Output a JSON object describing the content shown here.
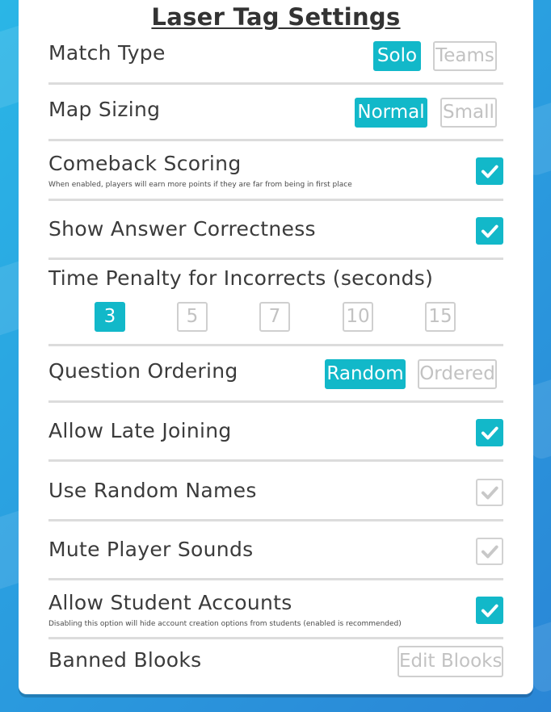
{
  "title": "Laser Tag Settings",
  "colors": {
    "accent": "#12b8c9",
    "inactive_border": "#cfcfcf",
    "text": "#3b3b3b"
  },
  "settings": {
    "match_type": {
      "label": "Match Type",
      "options": [
        "Solo",
        "Teams"
      ],
      "selected": "Solo"
    },
    "map_sizing": {
      "label": "Map Sizing",
      "options": [
        "Normal",
        "Small"
      ],
      "selected": "Normal"
    },
    "comeback_scoring": {
      "label": "Comeback Scoring",
      "description": "When enabled, players will earn more points if they are far from being in first place",
      "checked": true
    },
    "show_answer_correctness": {
      "label": "Show Answer Correctness",
      "checked": true
    },
    "time_penalty": {
      "label": "Time Penalty for Incorrects (seconds)",
      "options": [
        "3",
        "5",
        "7",
        "10",
        "15"
      ],
      "selected": "3"
    },
    "question_ordering": {
      "label": "Question Ordering",
      "options": [
        "Random",
        "Ordered"
      ],
      "selected": "Random"
    },
    "allow_late_joining": {
      "label": "Allow Late Joining",
      "checked": true
    },
    "use_random_names": {
      "label": "Use Random Names",
      "checked": false
    },
    "mute_player_sounds": {
      "label": "Mute Player Sounds",
      "checked": false
    },
    "allow_student_accounts": {
      "label": "Allow Student Accounts",
      "description": "Disabling this option will hide account creation options from students (enabled is recommended)",
      "checked": true
    },
    "banned_blooks": {
      "label": "Banned Blooks",
      "button": "Edit Blooks"
    }
  }
}
